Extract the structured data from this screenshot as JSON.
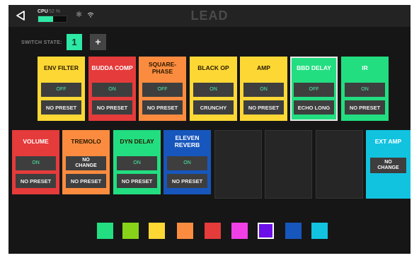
{
  "header": {
    "title": "LEAD",
    "cpu_label": "CPU",
    "cpu_percent": "52 %",
    "cpu_fill": 0.52
  },
  "switch_state": {
    "label": "SWITCH STATE:",
    "value": "1",
    "add": "+"
  },
  "row1": [
    {
      "name": "ENV FILTER",
      "state": "OFF",
      "preset": "NO PRESET",
      "color": "#fdd835"
    },
    {
      "name": "BUDDA COMP",
      "state": "ON",
      "preset": "NO PRESET",
      "color": "#e53b3b"
    },
    {
      "name": "SQUARE-\nPHASE",
      "state": "OFF",
      "preset": "NO PRESET",
      "color": "#fb8c3f"
    },
    {
      "name": "BLACK OP",
      "state": "ON",
      "preset": "CRUNCHY",
      "color": "#fdd835"
    },
    {
      "name": "AMP",
      "state": "ON",
      "preset": "NO PRESET",
      "color": "#fdd835"
    },
    {
      "name": "BBD DELAY",
      "state": "OFF",
      "preset": "ECHO LONG",
      "color": "#22de80"
    },
    {
      "name": "IR",
      "state": "ON",
      "preset": "NO PRESET",
      "color": "#22de80"
    }
  ],
  "row2": [
    {
      "name": "VOLUME",
      "state": "ON",
      "preset": "NO PRESET",
      "color": "#e53b3b"
    },
    {
      "name": "TREMOLO",
      "state": "NO\nCHANGE",
      "preset": "NO PRESET",
      "color": "#fb8c3f"
    },
    {
      "name": "DYN DELAY",
      "state": "ON",
      "preset": "NO PRESET",
      "color": "#22de80"
    },
    {
      "name": "ELEVEN\nREVERB",
      "state": "ON",
      "preset": "NO PRESET",
      "color": "#1757bd"
    }
  ],
  "ext_amp": {
    "name": "EXT AMP",
    "state": "NO\nCHANGE",
    "color": "#12c3e0"
  },
  "palette": [
    {
      "name": "green",
      "color": "#22de80"
    },
    {
      "name": "lime",
      "color": "#87d31a"
    },
    {
      "name": "yellow",
      "color": "#fdd835"
    },
    {
      "name": "orange",
      "color": "#fb8c3f"
    },
    {
      "name": "red",
      "color": "#e53b3b"
    },
    {
      "name": "pink",
      "color": "#f13fe6"
    },
    {
      "name": "purple",
      "color": "#6b0ee8"
    },
    {
      "name": "blue",
      "color": "#1757bd"
    },
    {
      "name": "cyan",
      "color": "#12c3e0"
    }
  ]
}
